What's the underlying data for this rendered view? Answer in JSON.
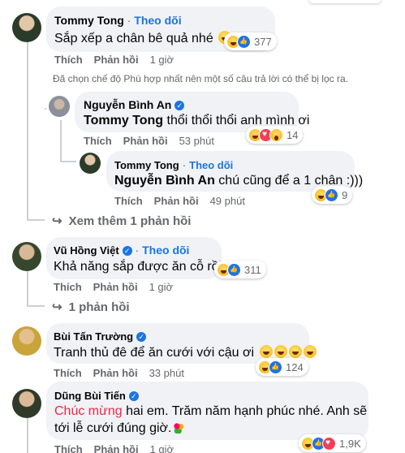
{
  "comments": {
    "c1": {
      "name": "Tommy Tong",
      "follow": "Theo dõi",
      "text": "Sắp xếp a chân bê quả nhé",
      "reaction_count": "377",
      "like": "Thích",
      "reply": "Phản hồi",
      "time": "1 giờ"
    },
    "filter_note": "Đã chọn chế độ Phù hợp nhất nên một số câu trả lời có thể bị lọc ra.",
    "r1": {
      "name": "Nguyễn Bình An",
      "mention": "Tommy Tong",
      "text": "thổi thổi thổi anh mình ơi",
      "reaction_count": "14",
      "like": "Thích",
      "reply": "Phản hồi",
      "time": "53 phút"
    },
    "r2": {
      "name": "Tommy Tong",
      "follow": "Theo dõi",
      "mention": "Nguyễn Bình An",
      "text": "chú cũng để a 1 chân :)))",
      "reaction_count": "9",
      "like": "Thích",
      "reply": "Phản hồi",
      "time": "49 phút"
    },
    "more1": "Xem thêm 1 phản hồi",
    "c2": {
      "name": "Vũ Hồng Việt",
      "follow": "Theo dõi",
      "text": "Khả năng sắp được ăn cỗ rồi",
      "reaction_count": "311",
      "like": "Thích",
      "reply": "Phản hồi",
      "time": "1 giờ"
    },
    "more2": "1 phản hồi",
    "c3": {
      "name": "Bùi Tấn Trường",
      "text": "Tranh thủ đê để ăn cưới với cậu ơi",
      "reaction_count": "124",
      "like": "Thích",
      "reply": "Phản hồi",
      "time": "33 phút"
    },
    "c4": {
      "name": "Dũng Bùi Tiến",
      "highlight": "Chúc mừng",
      "text_line1": "hai em. Trăm năm hạnh phúc nhé. Anh sẽ",
      "text_line2": "tới lễ cưới đúng giờ.",
      "reaction_count": "1,9K",
      "like": "Thích",
      "reply": "Phản hồi",
      "time": "1 giờ"
    }
  },
  "colors": {
    "link_blue": "#1b74e4",
    "bubble_bg": "#f0f2f5",
    "meta_gray": "#65676b",
    "highlight_red": "#f0284a"
  }
}
